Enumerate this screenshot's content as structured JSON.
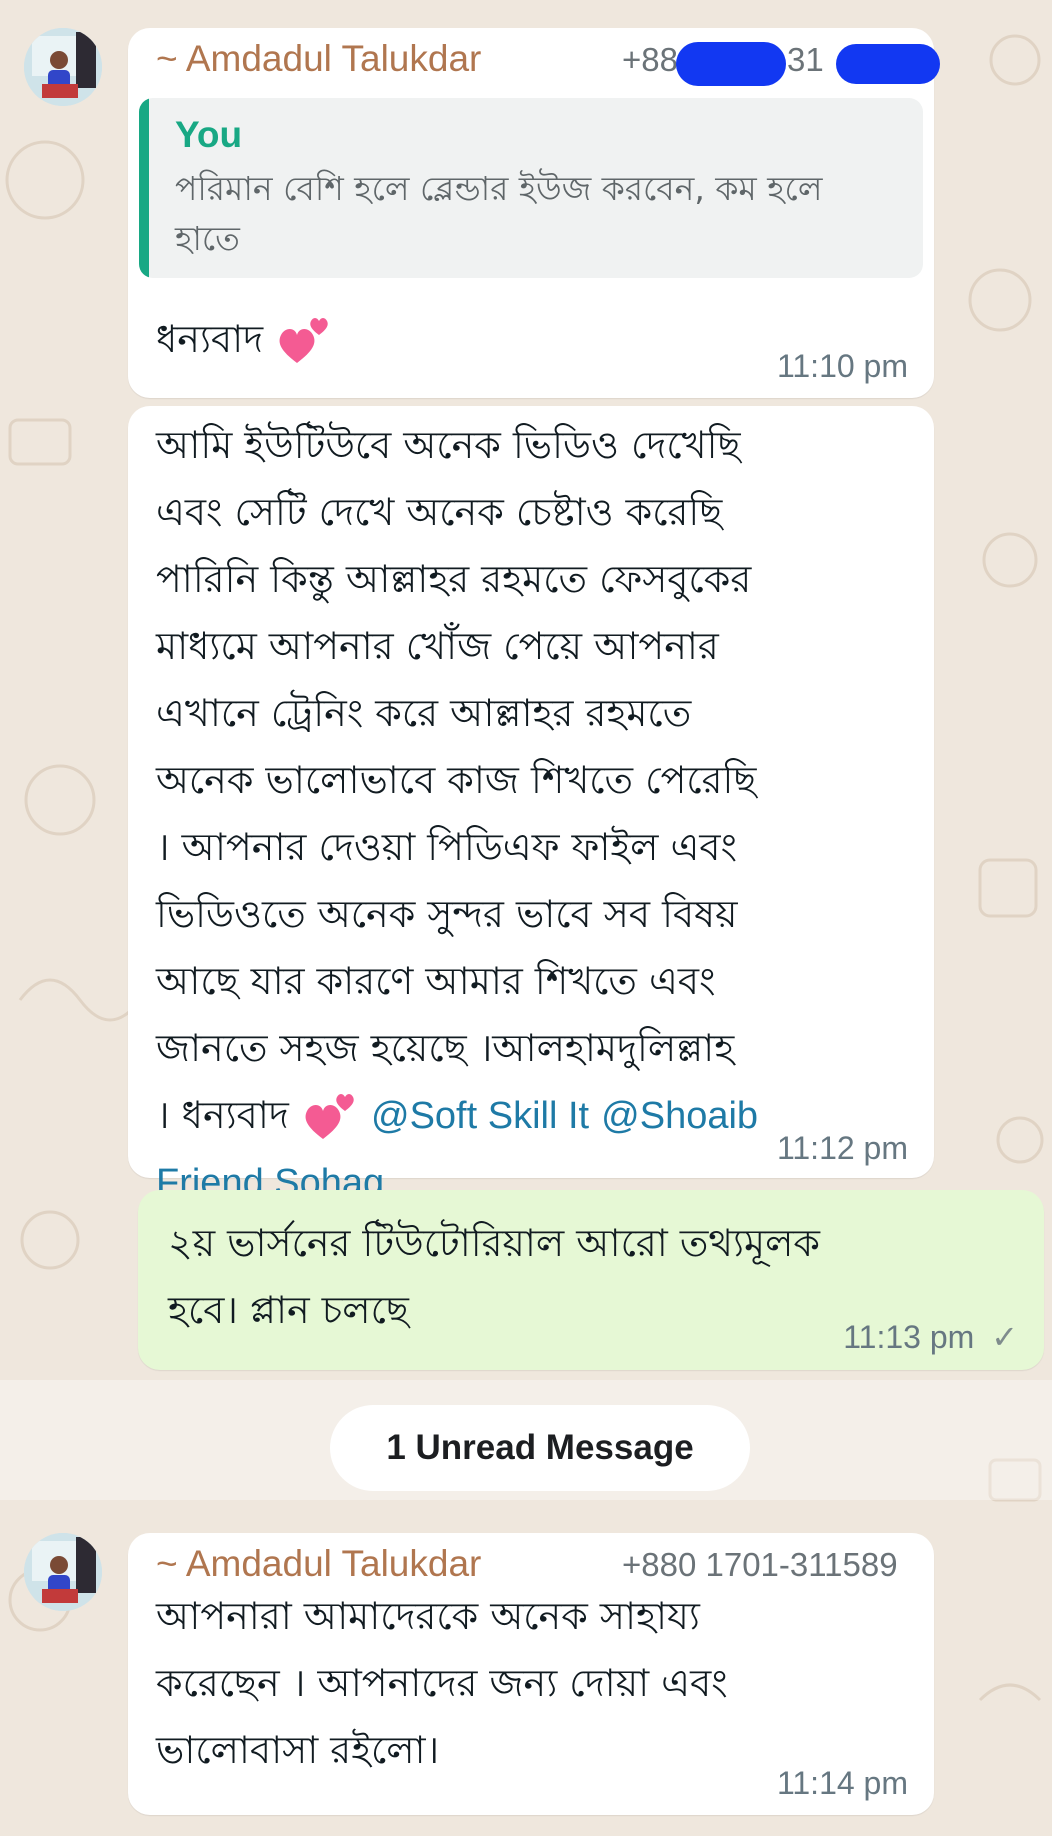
{
  "messages": [
    {
      "sender_name": "~ Amdadul Talukdar",
      "sender_phone_start": "+88",
      "sender_phone_mid": "-31",
      "quote": {
        "author": "You",
        "text": "পরিমান বেশি হলে ব্লেন্ডার ইউজ করবেন, কম হলে হাতে"
      },
      "text": "ধন্যবাদ",
      "time": "11:10 pm"
    },
    {
      "lines": [
        "আমি ইউটিউবে অনেক ভিডিও দেখেছি",
        "এবং সেটি দেখে অনেক চেষ্টাও করেছি",
        "পারিনি কিন্তু আল্লাহর রহমতে ফেসবুকের",
        "মাধ্যমে আপনার খোঁজ পেয়ে আপনার",
        "এখানে ট্রেনিং করে আল্লাহর রহমতে",
        "অনেক ভালোভাবে কাজ শিখতে পেরেছি",
        "। আপনার দেওয়া পিডিএফ ফাইল এবং",
        "ভিডিওতে অনেক সুন্দর ভাবে সব বিষয়",
        "আছে যার কারণে আমার শিখতে এবং",
        "জানতে সহজ হয়েছে ।আলহামদুলিল্লাহ"
      ],
      "last_line_prefix": "। ধন্যবাদ",
      "mention1": "@Soft Skill It",
      "mention2": "@Shoaib",
      "mention2_cont": "Friend Sohag",
      "time": "11:12 pm"
    },
    {
      "lines": [
        "২য় ভার্সনের টিউটোরিয়াল আরো তথ্যমূলক",
        "হবে। প্লান চলছে"
      ],
      "time": "11:13 pm",
      "status_icon": "✓"
    },
    {
      "sender_name": "~ Amdadul Talukdar",
      "sender_phone": "+880 1701-311589",
      "lines": [
        "আপনারা আমাদেরকে অনেক সাহায্য",
        "করেছেন । আপনাদের জন্য দোয়া এবং",
        "ভালোবাসা রইলো।"
      ],
      "time": "11:14 pm"
    }
  ],
  "unread_label": "1 Unread Message",
  "colors": {
    "background": "#efe7dd",
    "incoming_bubble": "#ffffff",
    "outgoing_bubble": "#e6f8d5",
    "sender_name": "#b0764f",
    "quote_accent": "#18a884",
    "mention": "#1e7aa6"
  }
}
